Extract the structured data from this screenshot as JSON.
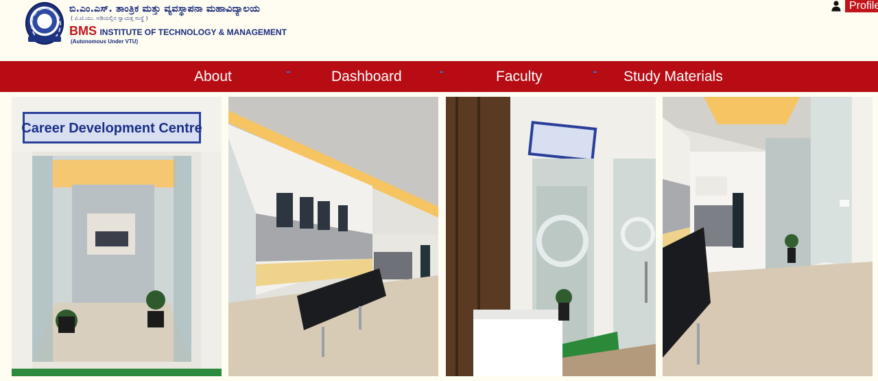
{
  "header": {
    "kannada_title": "ಬಿ.ಎಂ.ಎಸ್. ತಾಂತ್ರಿಕ ಮತ್ತು ವ್ಯವಸ್ಥಾಪನಾ ಮಹಾವಿದ್ಯಾಲಯ",
    "kannada_subtitle": "( ವಿ.ಟಿ.ಯು. ಅಡಿಯಲ್ಲಿನ ಸ್ವಾಯತ್ತ ಸಂಸ್ಥೆ )",
    "english_bms": "BMS",
    "english_rest": "INSTITUTE OF TECHNOLOGY & MANAGEMENT",
    "english_sub": "(Autonomous Under VTU)",
    "profile_label": "Profile"
  },
  "nav": {
    "items": [
      {
        "label": "About"
      },
      {
        "label": "Dashboard"
      },
      {
        "label": "Faculty"
      },
      {
        "label": "Study Materials"
      }
    ]
  },
  "gallery": {
    "sign_text": "Career Development Centre",
    "images": [
      {
        "alt": "career-development-centre-entrance"
      },
      {
        "alt": "waiting-lounge"
      },
      {
        "alt": "centre-glass-door"
      },
      {
        "alt": "corridor"
      }
    ]
  },
  "colors": {
    "nav_bg": "#b80c15",
    "page_bg": "#fffdf1",
    "brand_blue": "#1a2a7a",
    "brand_red": "#c0151b"
  }
}
